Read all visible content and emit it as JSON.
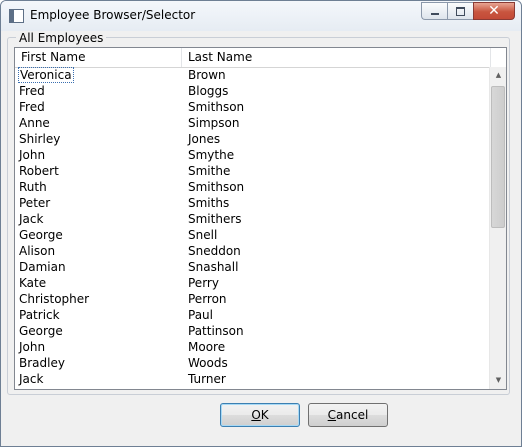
{
  "window": {
    "title": "Employee Browser/Selector",
    "close_glyph": "✕"
  },
  "group": {
    "label": "All Employees"
  },
  "list": {
    "columns": [
      "First Name",
      "Last Name"
    ],
    "selected_index": 0,
    "rows": [
      [
        "Veronica",
        "Brown"
      ],
      [
        "Fred",
        "Bloggs"
      ],
      [
        "Fred",
        "Smithson"
      ],
      [
        "Anne",
        "Simpson"
      ],
      [
        "Shirley",
        "Jones"
      ],
      [
        "John",
        "Smythe"
      ],
      [
        "Robert",
        "Smithe"
      ],
      [
        "Ruth",
        "Smithson"
      ],
      [
        "Peter",
        "Smiths"
      ],
      [
        "Jack",
        "Smithers"
      ],
      [
        "George",
        "Snell"
      ],
      [
        "Alison",
        "Sneddon"
      ],
      [
        "Damian",
        "Snashall"
      ],
      [
        "Kate",
        "Perry"
      ],
      [
        "Christopher",
        "Perron"
      ],
      [
        "Patrick",
        "Paul"
      ],
      [
        "George",
        "Pattinson"
      ],
      [
        "John",
        "Moore"
      ],
      [
        "Bradley",
        "Woods"
      ],
      [
        "Jack",
        "Turner"
      ]
    ]
  },
  "buttons": {
    "ok_prefix": "",
    "ok_mnemonic": "O",
    "ok_rest": "K",
    "cancel_prefix": "",
    "cancel_mnemonic": "C",
    "cancel_rest": "ancel"
  },
  "icons": {
    "app": "window-icon",
    "minimize": "minimize-icon",
    "maximize": "maximize-icon",
    "close": "close-icon",
    "scroll_up": "▲",
    "scroll_down": "▼"
  }
}
